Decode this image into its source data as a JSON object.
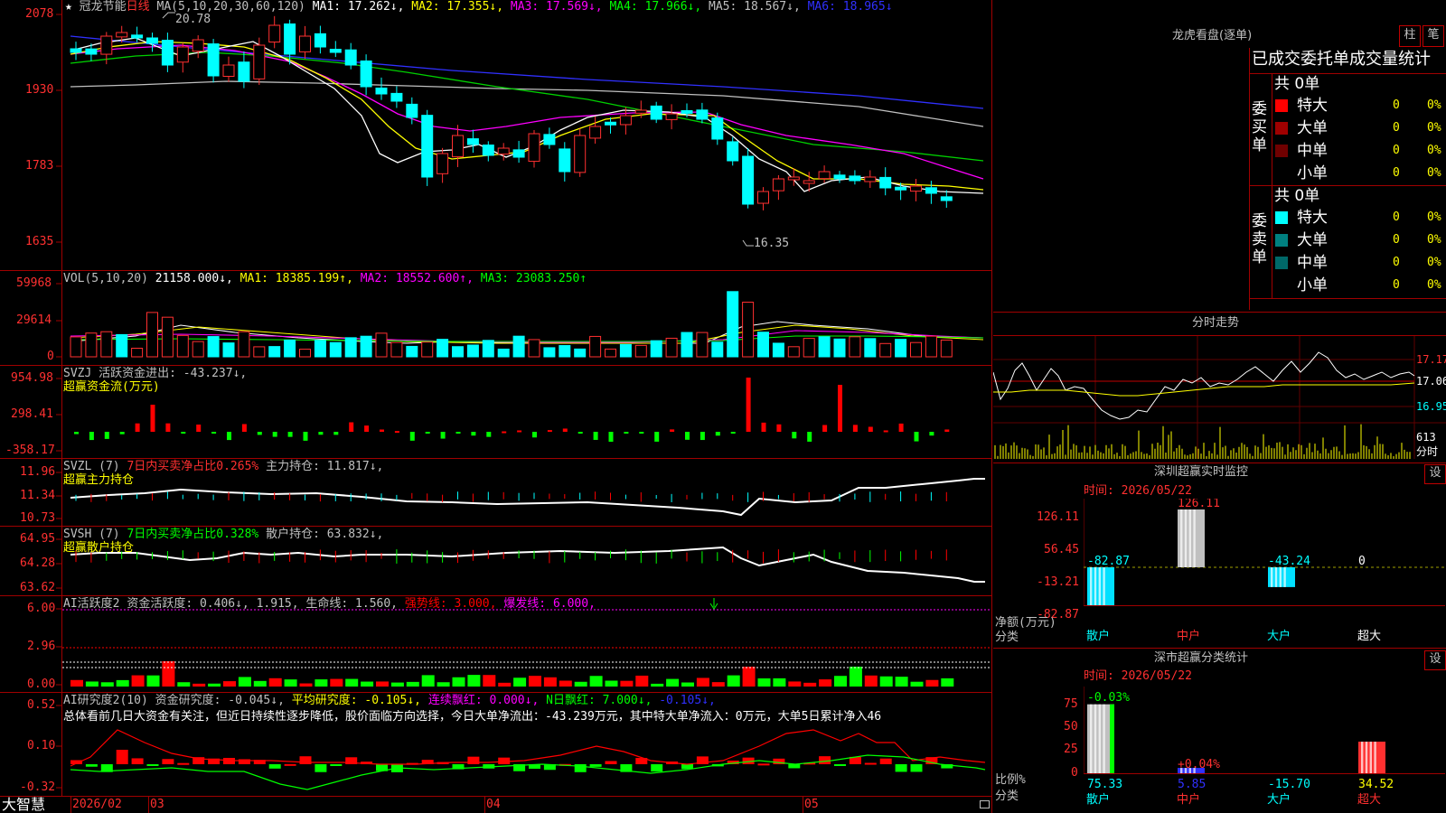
{
  "stock": {
    "star": "★",
    "name": "冠龙节能",
    "period": "日线",
    "ma_spec": "MA(5,10,20,30,60,120)"
  },
  "ma_header": [
    {
      "label": "MA1: 17.262↓,",
      "color": "#ffffff"
    },
    {
      "label": "MA2: 17.355↓,",
      "color": "#ffff00"
    },
    {
      "label": "MA3: 17.569↓,",
      "color": "#ff00ff"
    },
    {
      "label": "MA4: 17.966↓,",
      "color": "#00ff00"
    },
    {
      "label": "MA5: 18.567↓,",
      "color": "#c0c0c0"
    },
    {
      "label": "MA6: 18.965↓",
      "color": "#3030ff"
    }
  ],
  "price_axis": [
    "2078",
    "1930",
    "1783",
    "1635"
  ],
  "price_annotations": {
    "high": "20.78",
    "low": "16.35"
  },
  "vol_header": {
    "spec": "VOL(5,10,20)",
    "vol": "21158.000↓,",
    "ma1": "MA1: 18385.199↑,",
    "ma2": "MA2: 18552.600↑,",
    "ma3": "MA3: 23083.250↑"
  },
  "vol_axis": [
    "59968",
    "29614",
    "0"
  ],
  "svzj": {
    "line1": "SVZJ  活跃资金进出: -43.237↓,",
    "line2": "超赢资金流(万元)",
    "axis": [
      "954.98",
      "298.41",
      "-358.17"
    ]
  },
  "svzl": {
    "spec": "SVZL (7)",
    "ratio": "7日内买卖净占比0.265%",
    "hold": "主力持仓: 11.817↓,",
    "line2": "超赢主力持仓",
    "axis": [
      "11.96",
      "11.34",
      "10.73"
    ]
  },
  "svsh": {
    "spec": "SVSH (7)",
    "ratio": "7日内买卖净占比0.328%",
    "hold": "散户持仓: 63.832↓,",
    "line2": "超赢散户持仓",
    "axis": [
      "64.95",
      "64.28",
      "63.62"
    ]
  },
  "ai_active": {
    "spec": "AI活跃度2",
    "a": "资金活跃度: 0.406↓,",
    "b": "1.915,",
    "c": "生命线: 1.560,",
    "d": "强势线: 3.000,",
    "e": "爆发线: 6.000,",
    "arrow": "↓",
    "axis": [
      "6.00",
      "2.96",
      "0.00"
    ]
  },
  "ai_research": {
    "spec": "AI研究度2(10)",
    "a": "资金研究度: -0.045↓,",
    "b": "平均研究度: -0.105↓,",
    "c": "连续飘红: 0.000↓,",
    "d": "N日飘红: 7.000↓,",
    "e": "-0.105↓,",
    "summary": "总体看前几日大资金有关注，但近日持续性逐步降低，股价面临方向选择，今日大单净流出：-43.239万元，其中特大单净流入：0万元，大单5日累计净入46",
    "axis": [
      "0.52",
      "0.10",
      "-0.32"
    ]
  },
  "bottom_bar": {
    "logo": "大智慧",
    "dates": [
      "2026/02",
      "03",
      "04",
      "05"
    ]
  },
  "right": {
    "top_title": "龙虎看盘(逐单)",
    "btn_col": "柱",
    "btn_bi": "笔",
    "table_title": "已成交委托单成交量统计",
    "buy": {
      "label": "委买单",
      "total": "共 0单",
      "rows": [
        {
          "name": "特大",
          "color": "#ff0000",
          "v": "0",
          "p": "0%"
        },
        {
          "name": "大单",
          "color": "#a00000",
          "v": "0",
          "p": "0%"
        },
        {
          "name": "中单",
          "color": "#700000",
          "v": "0",
          "p": "0%"
        },
        {
          "name": "小单",
          "color": "#000000",
          "v": "0",
          "p": "0%"
        }
      ]
    },
    "sell": {
      "label": "委卖单",
      "total": "共 0单",
      "rows": [
        {
          "name": "特大",
          "color": "#00ffff",
          "v": "0",
          "p": "0%"
        },
        {
          "name": "大单",
          "color": "#008080",
          "v": "0",
          "p": "0%"
        },
        {
          "name": "中单",
          "color": "#006868",
          "v": "0",
          "p": "0%"
        },
        {
          "name": "小单",
          "color": "#000000",
          "v": "0",
          "p": "0%"
        }
      ]
    },
    "intraday_title": "分时走势",
    "intraday_axis": [
      "17.17",
      "17.06",
      "16.95",
      "613",
      "分时"
    ],
    "monitor": {
      "title": "深圳超赢实时监控",
      "btn": "设",
      "time": "时间: 2026/05/22",
      "axis": [
        "126.11",
        "56.45",
        "-13.21",
        "-82.87"
      ],
      "ylabel1": "净额(万元)",
      "ylabel2": "分类",
      "cats": [
        "散户",
        "中户",
        "大户",
        "超大"
      ],
      "values": [
        "-82.87",
        "126.11",
        "-43.24",
        "0"
      ]
    },
    "classify": {
      "title": "深市超赢分类统计",
      "btn": "设",
      "time": "时间: 2026/05/22",
      "axis": [
        "75",
        "50",
        "25",
        "0"
      ],
      "ylabel1": "比例%",
      "ylabel2": "分类",
      "cats": [
        "散户",
        "中户",
        "大户",
        "超大"
      ],
      "values": [
        "75.33",
        "5.85",
        "-15.70",
        "34.52"
      ],
      "tops": [
        "-0.03%",
        "+0.04%"
      ]
    }
  },
  "chart_data": [
    {
      "type": "bar",
      "title": "深圳超赢实时监控",
      "xlabel": "分类",
      "ylabel": "净额(万元)",
      "categories": [
        "散户",
        "中户",
        "大户",
        "超大"
      ],
      "values": [
        -82.87,
        126.11,
        -43.24,
        0
      ],
      "ylim": [
        -82.87,
        126.11
      ]
    },
    {
      "type": "bar",
      "title": "深市超赢分类统计",
      "xlabel": "分类",
      "ylabel": "比例%",
      "categories": [
        "散户",
        "中户",
        "大户",
        "超大"
      ],
      "values": [
        75.33,
        5.85,
        -15.7,
        34.52
      ],
      "ylim": [
        0,
        75
      ]
    }
  ]
}
